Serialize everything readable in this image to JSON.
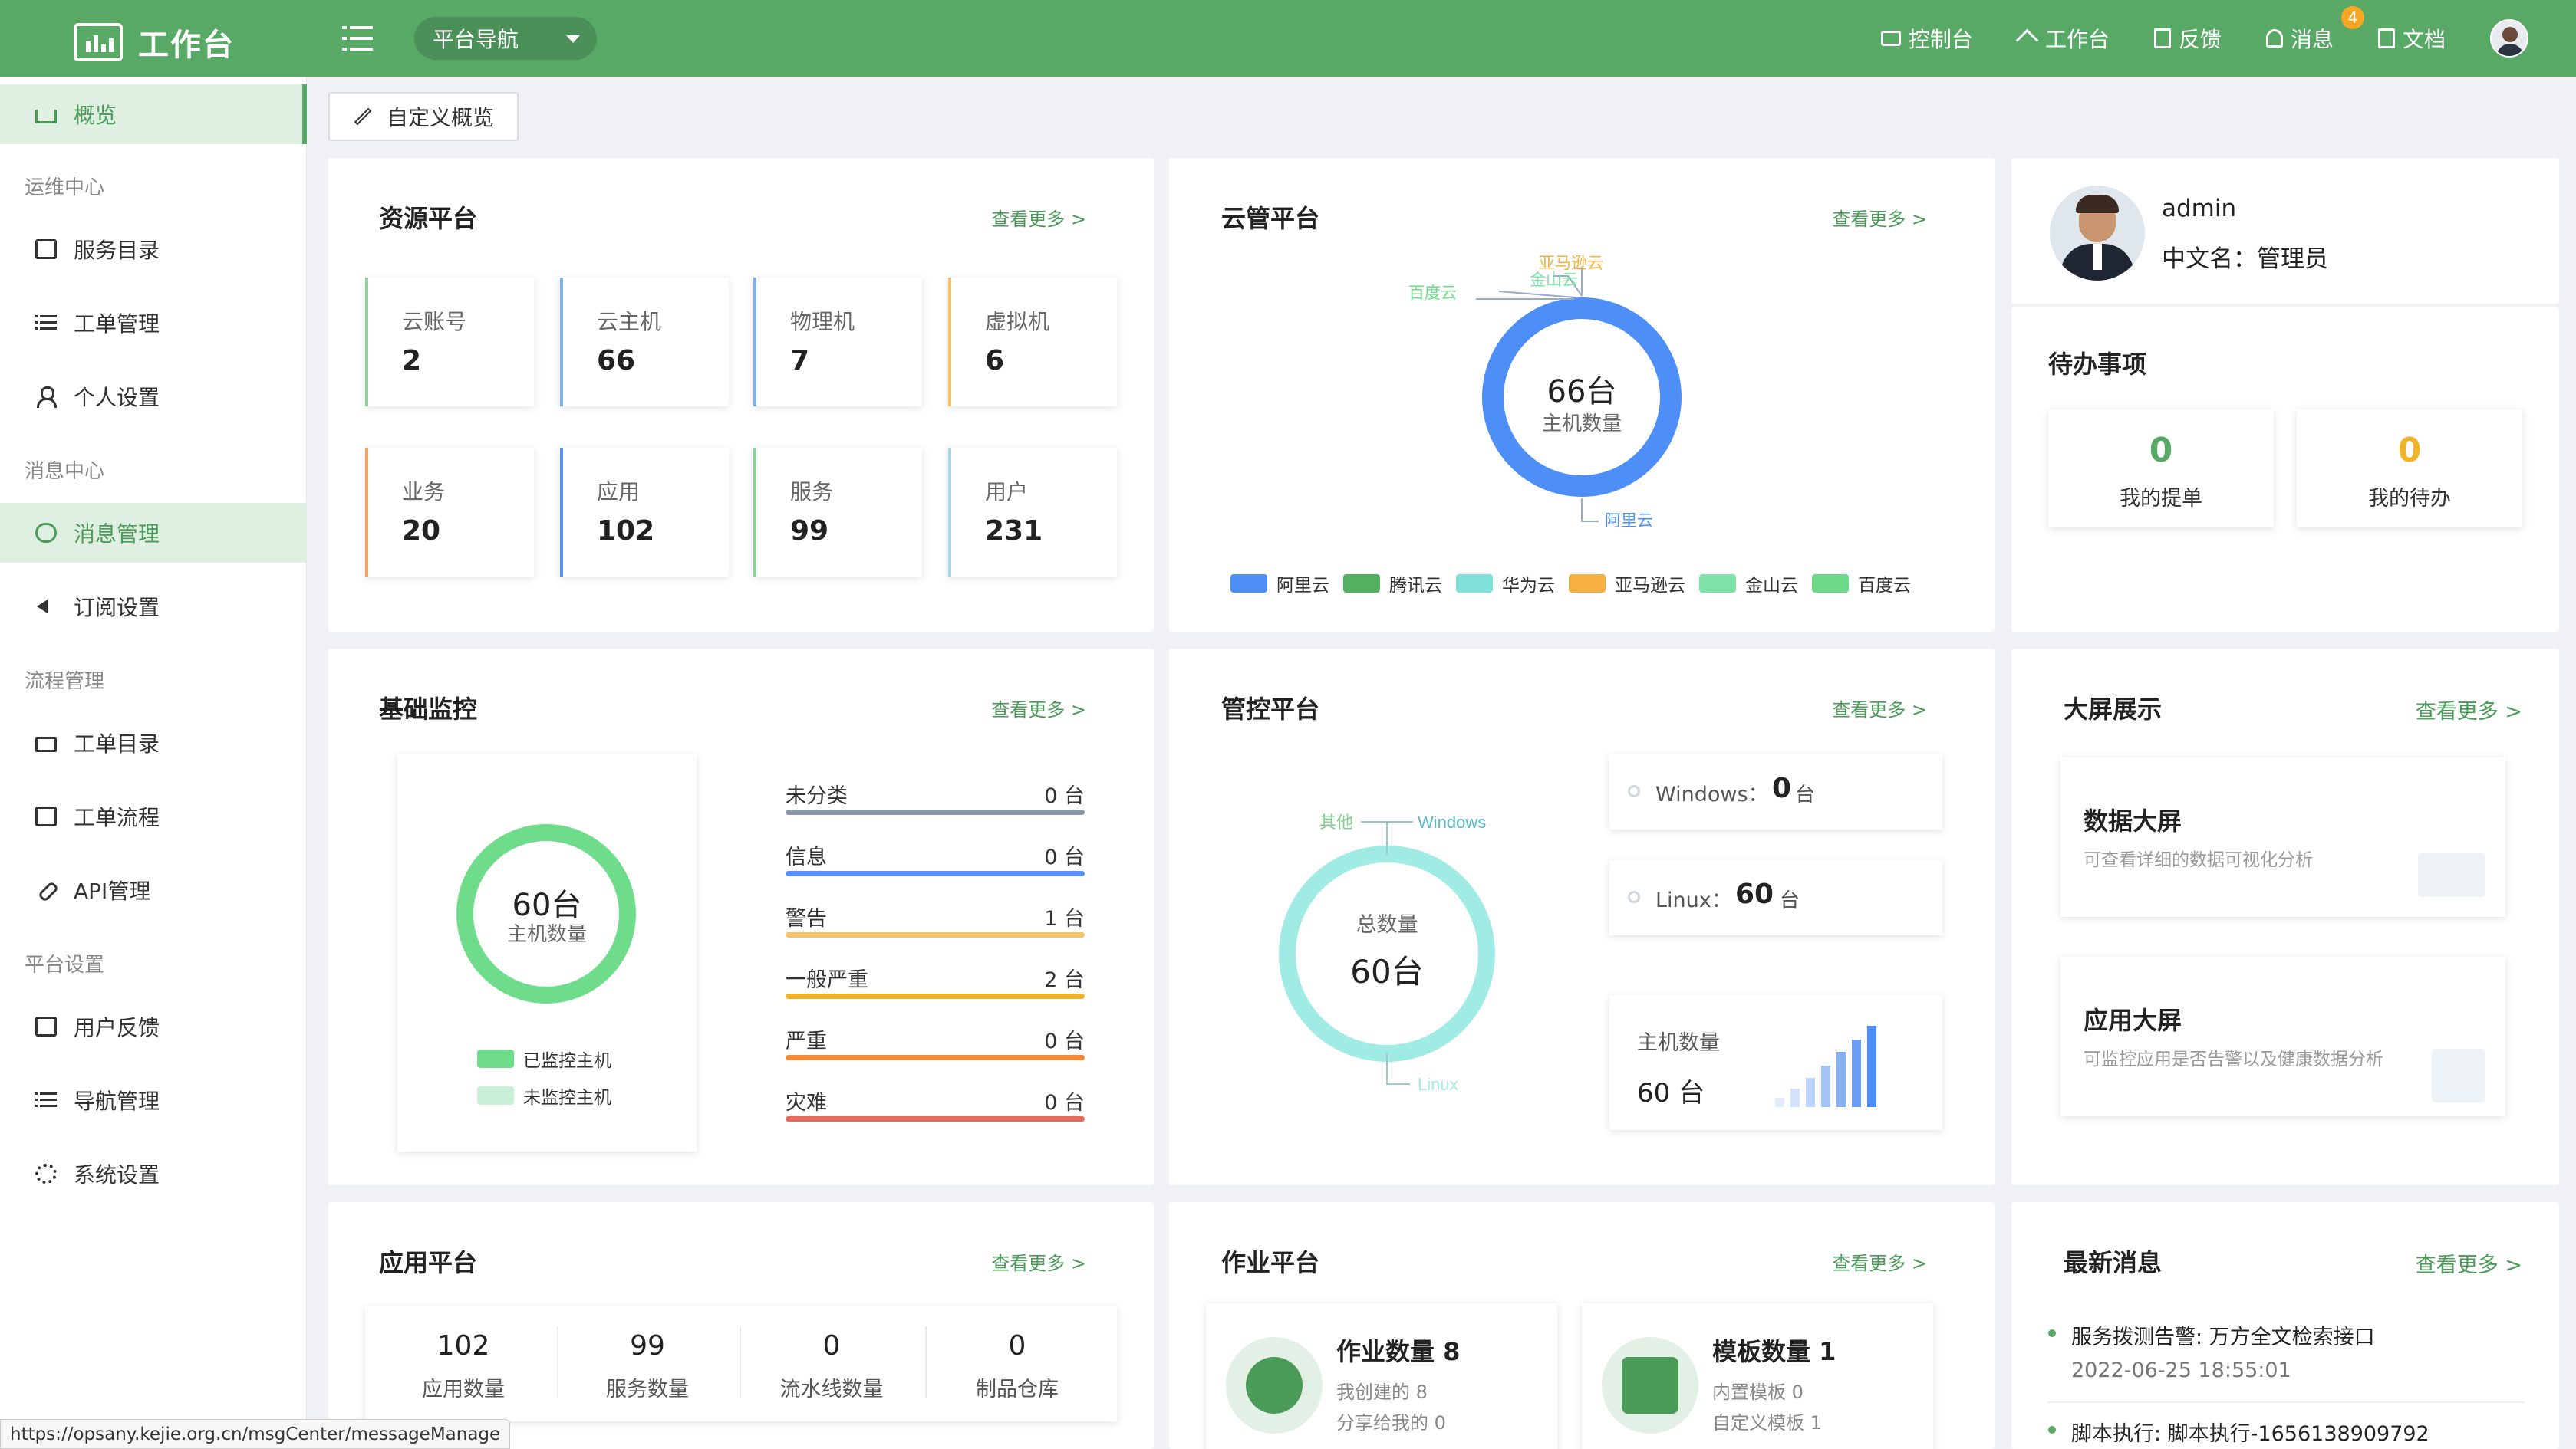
{
  "header": {
    "app_title": "工作台",
    "nav_dropdown": "平台导航",
    "links": [
      {
        "label": "控制台",
        "icon": "monitor-icon"
      },
      {
        "label": "工作台",
        "icon": "home-icon"
      },
      {
        "label": "反馈",
        "icon": "feedback-icon"
      },
      {
        "label": "消息",
        "icon": "bell-icon",
        "badge": "4"
      },
      {
        "label": "文档",
        "icon": "document-icon"
      }
    ]
  },
  "sidebar": {
    "overview": "概览",
    "groups": [
      {
        "title": "运维中心",
        "items": [
          "服务目录",
          "工单管理",
          "个人设置"
        ]
      },
      {
        "title": "消息中心",
        "items": [
          "消息管理",
          "订阅设置"
        ]
      },
      {
        "title": "流程管理",
        "items": [
          "工单目录",
          "工单流程",
          "API管理"
        ]
      },
      {
        "title": "平台设置",
        "items": [
          "用户反馈",
          "导航管理",
          "系统设置"
        ]
      }
    ]
  },
  "toolbar": {
    "customize_label": "自定义概览"
  },
  "more_label": "查看更多 >",
  "resource_platform": {
    "title": "资源平台",
    "stats": [
      {
        "label": "云账号",
        "value": "2"
      },
      {
        "label": "云主机",
        "value": "66"
      },
      {
        "label": "物理机",
        "value": "7"
      },
      {
        "label": "虚拟机",
        "value": "6"
      },
      {
        "label": "业务",
        "value": "20"
      },
      {
        "label": "应用",
        "value": "102"
      },
      {
        "label": "服务",
        "value": "99"
      },
      {
        "label": "用户",
        "value": "231"
      }
    ],
    "accent_colors": [
      "#8fd19e",
      "#7fb3f0",
      "#7fb3f0",
      "#f5c26b",
      "#f2a05a",
      "#5b8ff9",
      "#8fd19e",
      "#a8d8f0"
    ]
  },
  "cloud_platform": {
    "title": "云管平台",
    "center_value": "66台",
    "center_label": "主机数量",
    "callouts": [
      "亚马逊云",
      "腾讯云",
      "金山云",
      "百度云",
      "阿里云"
    ],
    "legend": [
      {
        "label": "阿里云",
        "color": "#4d8ef7"
      },
      {
        "label": "腾讯云",
        "color": "#52b060"
      },
      {
        "label": "华为云",
        "color": "#7fe0d8"
      },
      {
        "label": "亚马逊云",
        "color": "#f5b041"
      },
      {
        "label": "金山云",
        "color": "#7fe3a8"
      },
      {
        "label": "百度云",
        "color": "#6fd98a"
      }
    ]
  },
  "profile": {
    "username": "admin",
    "cn_name_label": "中文名：",
    "cn_name": "管理员",
    "todo_title": "待办事项",
    "todos": [
      {
        "value": "0",
        "label": "我的提单",
        "color": "#58a866"
      },
      {
        "value": "0",
        "label": "我的待办",
        "color": "#f0b429"
      }
    ]
  },
  "basic_monitor": {
    "title": "基础监控",
    "center_value": "60台",
    "center_label": "主机数量",
    "legend": [
      {
        "label": "已监控主机",
        "color": "#6fdc8c"
      },
      {
        "label": "未监控主机",
        "color": "#c9f0d6"
      }
    ],
    "levels": [
      {
        "name": "未分类",
        "count": "0 台",
        "color": "#8a9aaa"
      },
      {
        "name": "信息",
        "count": "0 台",
        "color": "#5b8ff9"
      },
      {
        "name": "警告",
        "count": "1 台",
        "color": "#f5c26b"
      },
      {
        "name": "一般严重",
        "count": "2 台",
        "color": "#f0b429"
      },
      {
        "name": "严重",
        "count": "0 台",
        "color": "#f08a3a"
      },
      {
        "name": "灾难",
        "count": "0 台",
        "color": "#e86a5a"
      }
    ]
  },
  "control_platform": {
    "title": "管控平台",
    "center_label": "总数量",
    "center_value": "60台",
    "callouts": [
      "其他",
      "Windows",
      "Linux"
    ],
    "windows_label": "Windows：",
    "windows_value": "0",
    "linux_label": "Linux：",
    "linux_value": "60",
    "unit": "台",
    "host_count_label": "主机数量",
    "host_count_value": "60 台"
  },
  "big_screen": {
    "title": "大屏展示",
    "items": [
      {
        "title": "数据大屏",
        "desc": "可查看详细的数据可视化分析"
      },
      {
        "title": "应用大屏",
        "desc": "可监控应用是否告警以及健康数据分析"
      }
    ]
  },
  "app_platform": {
    "title": "应用平台",
    "stats": [
      {
        "value": "102",
        "label": "应用数量"
      },
      {
        "value": "99",
        "label": "服务数量"
      },
      {
        "value": "0",
        "label": "流水线数量"
      },
      {
        "value": "0",
        "label": "制品仓库"
      }
    ]
  },
  "job_platform": {
    "title": "作业平台",
    "job": {
      "title": "作业数量 8",
      "line1": "我创建的 8",
      "line2": "分享给我的 0"
    },
    "template": {
      "title": "模板数量 1",
      "line1": "内置模板 0",
      "line2": "自定义模板 1"
    }
  },
  "news": {
    "title": "最新消息",
    "items": [
      {
        "text": "服务拨测告警: 万方全文检索接口",
        "time": "2022-06-25 18:55:01"
      },
      {
        "text": "脚本执行: 脚本执行-1656138909792",
        "time": ""
      }
    ]
  },
  "status_url": "https://opsany.kejie.org.cn/msgCenter/messageManage"
}
